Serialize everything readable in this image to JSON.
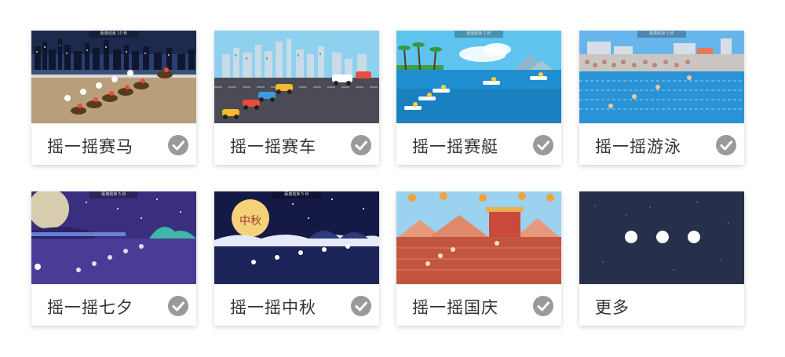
{
  "games": [
    {
      "label": "摇一摇赛马",
      "selected": true,
      "banner": "距离结束 10 秒",
      "theme": "horse-racing"
    },
    {
      "label": "摇一摇赛车",
      "selected": true,
      "banner": "",
      "theme": "car-racing"
    },
    {
      "label": "摇一摇赛艇",
      "selected": true,
      "banner": "距离结束 1 秒",
      "theme": "boat-racing"
    },
    {
      "label": "摇一摇游泳",
      "selected": true,
      "banner": "距离结束 5 秒",
      "theme": "swimming"
    },
    {
      "label": "摇一摇七夕",
      "selected": true,
      "banner": "距离结束 5 秒",
      "theme": "qixi"
    },
    {
      "label": "摇一摇中秋",
      "selected": true,
      "banner": "距离结束 5 秒",
      "theme": "mid-autumn",
      "moon_text": "中秋"
    },
    {
      "label": "摇一摇国庆",
      "selected": true,
      "banner": "",
      "theme": "national-day"
    }
  ],
  "more": {
    "label": "更多"
  },
  "colors": {
    "check_bg": "#9a9a9a",
    "more_bg": "#26304a",
    "label_text": "#333333"
  }
}
